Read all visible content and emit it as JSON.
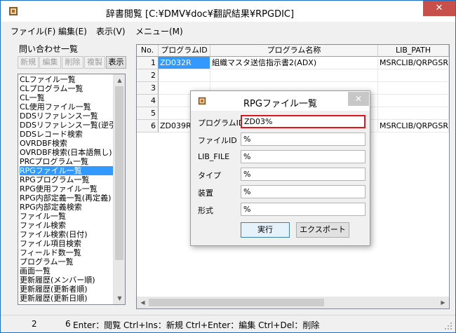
{
  "window": {
    "title": "辞書閲覧 [C:¥DMV¥doc¥翻訳結果¥RPGDIC]",
    "close_glyph": "✕"
  },
  "menu": [
    "ファイル(F)",
    "編集(E)",
    "表示(V)",
    "メニュー(M)"
  ],
  "query_panel": {
    "title": "問い合わせ一覧",
    "buttons": [
      "新規",
      "編集",
      "削除",
      "複製",
      "表示"
    ],
    "items": [
      "CLファイル一覧",
      "CLプログラム一覧",
      "CL一覧",
      "CL使用ファイル一覧",
      "DDSリファレンス一覧",
      "DDSリファレンス一覧(逆引き)",
      "DDSレコード検索",
      "OVRDBF検索",
      "OVRDBF検索(日本語無し)",
      "PRCプログラム一覧",
      "RPGファイル一覧",
      "RPGプログラム一覧",
      "RPG使用ファイル一覧",
      "RPG内部定義一覧(再定義)",
      "RPG内部定義検索",
      "ファイル一覧",
      "ファイル検索",
      "ファイル検索(日付)",
      "ファイル項目検索",
      "フィールド数一覧",
      "プログラム一覧",
      "画面一覧",
      "更新履歴(メンバー順)",
      "更新履歴(更新者順)",
      "更新履歴(更新日順)"
    ],
    "selected_index": 10
  },
  "grid": {
    "columns": [
      "No.",
      "プログラムID",
      "プログラム名称",
      "LIB_PATH"
    ],
    "rows": [
      {
        "no": "1",
        "id": "ZD032R",
        "name": "組織マスタ送信指示書2(ADX)",
        "lib": "MSRCLIB/QRPGSR"
      },
      {
        "no": "2",
        "id": "",
        "name": "",
        "lib": ""
      },
      {
        "no": "3",
        "id": "",
        "name": "",
        "lib": ""
      },
      {
        "no": "4",
        "id": "",
        "name": "",
        "lib": ""
      },
      {
        "no": "5",
        "id": "",
        "name": "",
        "lib": ""
      },
      {
        "no": "6",
        "id": "ZD039R",
        "name": "",
        "lib": "MSRCLIB/QRPGSR"
      }
    ]
  },
  "dialog": {
    "title": "RPGファイル一覧",
    "close_glyph": "✕",
    "fields": [
      {
        "label": "プログラムID",
        "value": "ZD03%"
      },
      {
        "label": "ファイルID",
        "value": "%"
      },
      {
        "label": "LIB_FILE",
        "value": "%"
      },
      {
        "label": "タイプ",
        "value": "%"
      },
      {
        "label": "装置",
        "value": "%"
      },
      {
        "label": "形式",
        "value": "%"
      }
    ],
    "run_label": "実行",
    "export_label": "エクスポート"
  },
  "status": {
    "count": "2",
    "row": "6",
    "hint": "Enter：閲覧 Ctrl+Ins：新規 Ctrl+Enter：編集 Ctrl+Del：削除"
  },
  "colors": {
    "selection": "#3399ff",
    "focus_border": "#e0141e",
    "window_border": "#1a6fc4",
    "close_red": "#c7504a"
  }
}
